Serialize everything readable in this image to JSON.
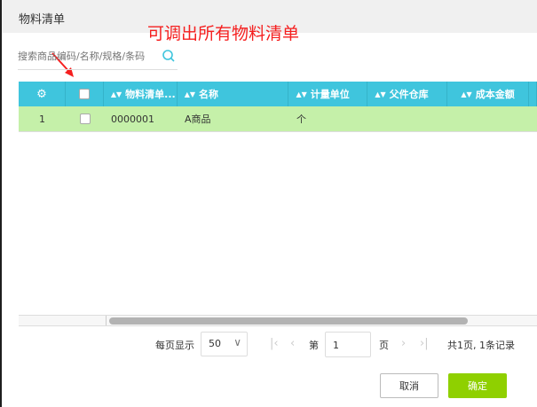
{
  "dialog": {
    "title": "物料清单",
    "annotation": "可调出所有物料清单"
  },
  "search": {
    "placeholder": "搜索商品编码/名称/规格/条码"
  },
  "table": {
    "headers": [
      "物料清单...",
      "名称",
      "计量单位",
      "父件仓库",
      "成本金额"
    ],
    "rows": [
      {
        "index": "1",
        "code": "0000001",
        "name": "A商品",
        "unit": "个",
        "warehouse": "",
        "cost": ""
      }
    ]
  },
  "pagination": {
    "per_page_label": "每页显示",
    "per_page": "50",
    "page_prefix": "第",
    "page": "1",
    "page_suffix": "页",
    "summary": "共1页, 1条记录"
  },
  "buttons": {
    "cancel": "取消",
    "ok": "确定"
  },
  "colors": {
    "header": "#3fc5dd",
    "row": "#c5f0a9",
    "ok": "#8fd000",
    "annotation": "#f51f1f"
  }
}
